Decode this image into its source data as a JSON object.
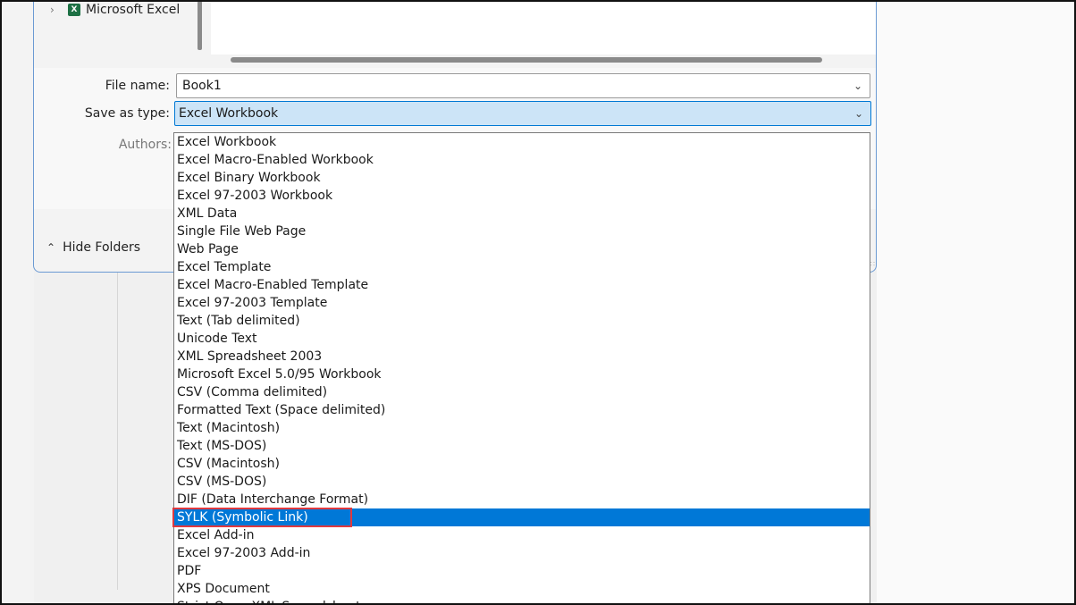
{
  "tree": {
    "item_label": "Microsoft Excel",
    "item_icon": "excel-icon"
  },
  "form": {
    "file_name_label": "File name:",
    "file_name_value": "Book1",
    "save_type_label": "Save as type:",
    "save_type_value": "Excel Workbook",
    "authors_label": "Authors:"
  },
  "hide_folders_label": "Hide Folders",
  "dropdown": {
    "options": [
      "Excel Workbook",
      "Excel Macro-Enabled Workbook",
      "Excel Binary Workbook",
      "Excel 97-2003 Workbook",
      "XML Data",
      "Single File Web Page",
      "Web Page",
      "Excel Template",
      "Excel Macro-Enabled Template",
      "Excel 97-2003 Template",
      "Text (Tab delimited)",
      "Unicode Text",
      "XML Spreadsheet 2003",
      "Microsoft Excel 5.0/95 Workbook",
      "CSV (Comma delimited)",
      "Formatted Text (Space delimited)",
      "Text (Macintosh)",
      "Text (MS-DOS)",
      "CSV (Macintosh)",
      "CSV (MS-DOS)",
      "DIF (Data Interchange Format)",
      "SYLK (Symbolic Link)",
      "Excel Add-in",
      "Excel 97-2003 Add-in",
      "PDF",
      "XPS Document",
      "Strict Open XML Spreadsheet"
    ],
    "active_index": 21
  },
  "colors": {
    "selection": "#0078d7",
    "highlight_box": "#e0393e",
    "field_selected": "#cce4f7"
  }
}
